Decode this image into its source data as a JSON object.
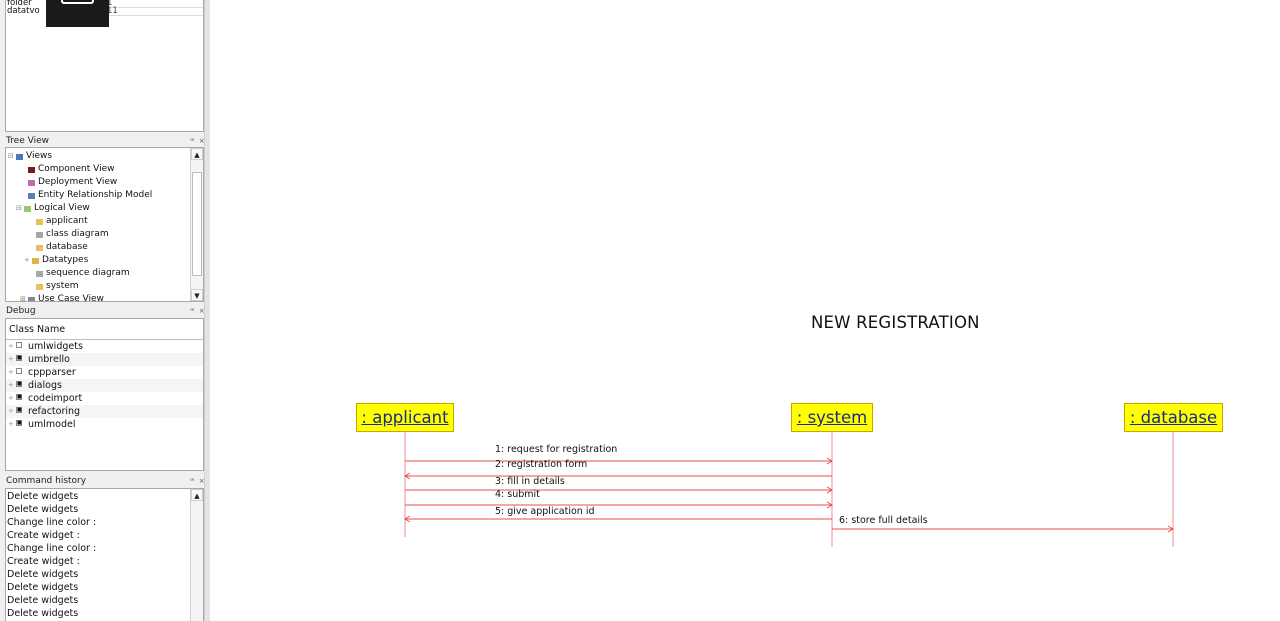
{
  "left_dock": {
    "properties": {
      "rows": [
        {
          "label": "folder",
          "value": "1"
        },
        {
          "label": "datatvo",
          "value": "11"
        }
      ]
    },
    "tree_view": {
      "title": "Tree View",
      "dock_buttons": "ꟹ ×",
      "items": [
        {
          "label": "Views",
          "icon": "folder-icon",
          "color": "#4a78b8",
          "expander": "⊟"
        },
        {
          "label": "Component View",
          "icon": "component-view-icon",
          "color": "#7b1a1a",
          "expander": ""
        },
        {
          "label": "Deployment View",
          "icon": "deployment-view-icon",
          "color": "#c46aa8",
          "expander": ""
        },
        {
          "label": "Entity Relationship Model",
          "icon": "er-model-icon",
          "color": "#5a7db5",
          "expander": ""
        },
        {
          "label": "Logical View",
          "icon": "logical-view-icon",
          "color": "#9ac76e",
          "expander": "⊟"
        },
        {
          "label": "applicant",
          "icon": "class-icon",
          "color": "#e8c15a",
          "expander": ""
        },
        {
          "label": "class diagram",
          "icon": "diagram-icon",
          "color": "#a6a6a6",
          "expander": ""
        },
        {
          "label": "database",
          "icon": "class-icon",
          "color": "#e8c15a",
          "expander": ""
        },
        {
          "label": "Datatypes",
          "icon": "folder-icon",
          "color": "#e0b545",
          "expander": "+"
        },
        {
          "label": "sequence diagram",
          "icon": "diagram-icon",
          "color": "#a6a6a6",
          "expander": ""
        },
        {
          "label": "system",
          "icon": "class-icon",
          "color": "#e8c15a",
          "expander": ""
        },
        {
          "label": "Use Case View",
          "icon": "usecase-view-icon",
          "color": "#7a8aa0",
          "expander": "⊞"
        }
      ]
    },
    "debug": {
      "title": "Debug",
      "dock_buttons": "ꟹ ×",
      "column_header": "Class Name",
      "items": [
        {
          "label": "umlwidgets",
          "checked": false
        },
        {
          "label": "umbrello",
          "checked": true
        },
        {
          "label": "cppparser",
          "checked": false
        },
        {
          "label": "dialogs",
          "checked": true
        },
        {
          "label": "codeimport",
          "checked": true
        },
        {
          "label": "refactoring",
          "checked": true
        },
        {
          "label": "umlmodel",
          "checked": true
        }
      ]
    },
    "command_history": {
      "title": "Command history",
      "dock_buttons": "ꟹ ×",
      "items": [
        "Delete widgets",
        "Delete widgets",
        "Change line color :",
        "Create widget :",
        "Change line color :",
        "Create widget :",
        "Delete widgets",
        "Delete widgets",
        "Delete widgets",
        "Delete widgets"
      ]
    }
  },
  "diagram": {
    "title": "NEW REGISTRATION",
    "lifelines": [
      {
        "id": "applicant",
        "label": ": applicant"
      },
      {
        "id": "system",
        "label": ": system"
      },
      {
        "id": "database",
        "label": ": database"
      }
    ],
    "messages": [
      {
        "label": "1: request for registration",
        "from": "applicant",
        "to": "system"
      },
      {
        "label": "2: registration form",
        "from": "system",
        "to": "applicant"
      },
      {
        "label": "3: fill in details",
        "from": "applicant",
        "to": "system"
      },
      {
        "label": "4: submit",
        "from": "applicant",
        "to": "system"
      },
      {
        "label": "5: give application id",
        "from": "system",
        "to": "applicant"
      },
      {
        "label": "6: store full details",
        "from": "system",
        "to": "database"
      }
    ],
    "colors": {
      "lifeline_fill": "#ffff00",
      "lifeline_text": "#1a2b8c",
      "message_line": "#e05050",
      "lifeline_line": "#e89090"
    }
  }
}
